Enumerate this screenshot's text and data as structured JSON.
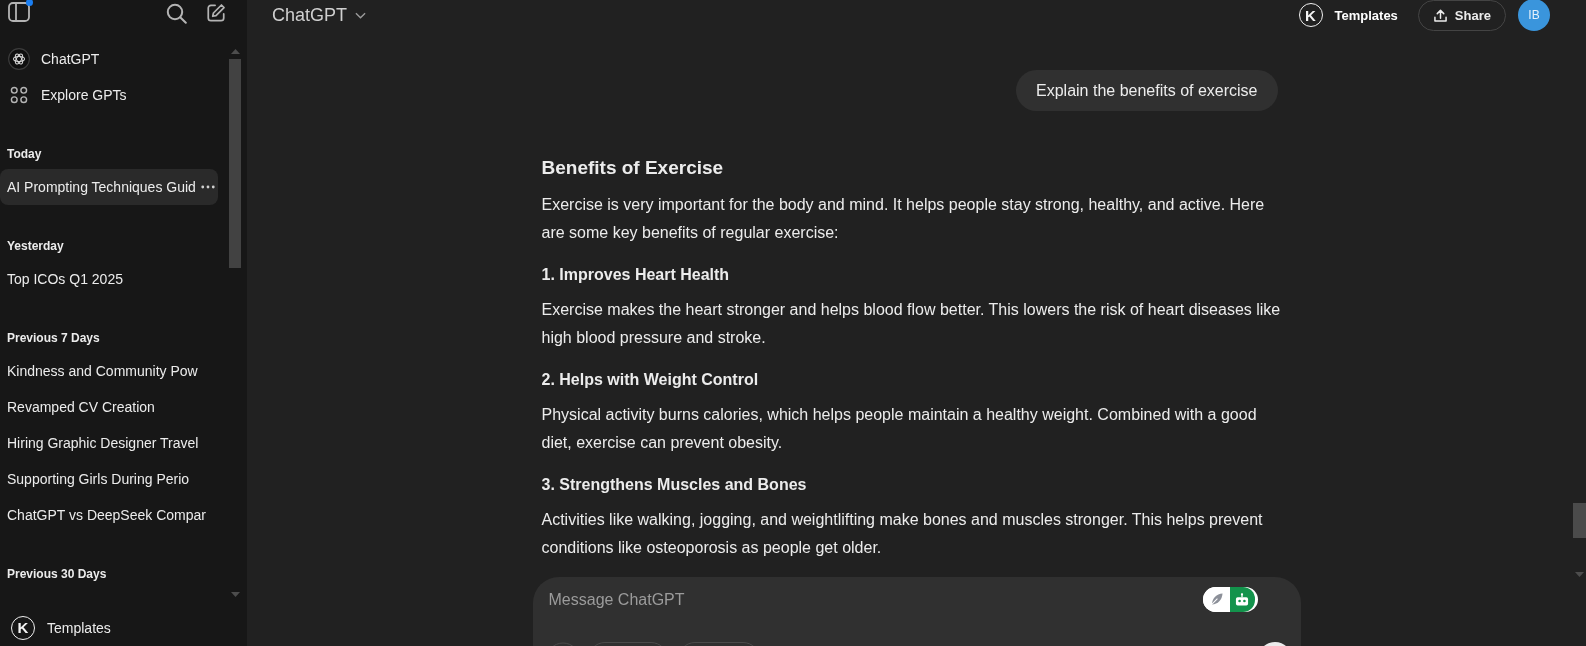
{
  "sidebar": {
    "toggle": {
      "notification": true
    },
    "nav": [
      {
        "kind": "model",
        "label": "ChatGPT"
      },
      {
        "kind": "explore",
        "label": "Explore GPTs"
      }
    ],
    "groups": [
      {
        "heading": "Today",
        "chats": [
          {
            "title": "AI Prompting Techniques Guid",
            "selected": true
          }
        ]
      },
      {
        "heading": "Yesterday",
        "chats": [
          {
            "title": "Top ICOs Q1 2025",
            "selected": false
          }
        ]
      },
      {
        "heading": "Previous 7 Days",
        "chats": [
          {
            "title": "Kindness and Community Pow",
            "selected": false
          },
          {
            "title": "Revamped CV Creation",
            "selected": false
          },
          {
            "title": "Hiring Graphic Designer Travel",
            "selected": false
          },
          {
            "title": "Supporting Girls During Perio",
            "selected": false
          },
          {
            "title": "ChatGPT vs DeepSeek Compar",
            "selected": false
          }
        ]
      },
      {
        "heading": "Previous 30 Days"
      }
    ],
    "footer": {
      "logo": "K",
      "label": "Templates"
    }
  },
  "header": {
    "model": "ChatGPT",
    "templates": {
      "logo": "K",
      "label": "Templates"
    },
    "share": "Share",
    "avatar": "IB"
  },
  "conversation": {
    "user_message": "Explain the benefits of exercise",
    "response": [
      {
        "kind": "heading",
        "text": "Benefits of Exercise"
      },
      {
        "kind": "paragraph",
        "text": "Exercise is very important for the body and mind. It helps people stay strong, healthy, and active. Here are some key benefits of regular exercise:"
      },
      {
        "kind": "subheading",
        "text": "1. Improves Heart Health"
      },
      {
        "kind": "paragraph",
        "text": "Exercise makes the heart stronger and helps blood flow better. This lowers the risk of heart diseases like high blood pressure and stroke."
      },
      {
        "kind": "subheading",
        "text": "2. Helps with Weight Control"
      },
      {
        "kind": "paragraph",
        "text": "Physical activity burns calories, which helps people maintain a healthy weight. Combined with a good diet, exercise can prevent obesity."
      },
      {
        "kind": "subheading",
        "text": "3. Strengthens Muscles and Bones"
      },
      {
        "kind": "paragraph",
        "text": "Activities like walking, jogging, and weightlifting make bones and muscles stronger. This helps prevent conditions like osteoporosis as people get older."
      }
    ]
  },
  "composer": {
    "placeholder": "Message ChatGPT",
    "modes": [
      {
        "kind": "feather",
        "selected": false
      },
      {
        "kind": "robot",
        "selected": true
      }
    ]
  }
}
